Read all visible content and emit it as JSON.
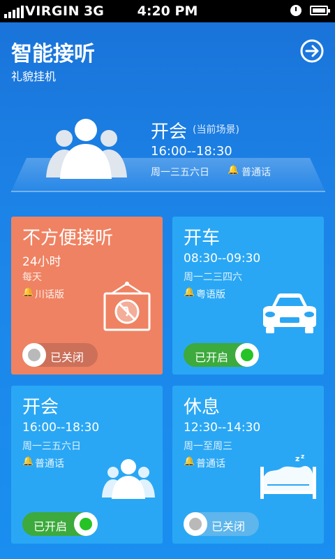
{
  "status_bar": {
    "carrier": "VIRGIN",
    "network": "3G",
    "time": "4:20 PM"
  },
  "header": {
    "title": "智能接听",
    "subtitle": "礼貌挂机"
  },
  "current": {
    "name": "开会",
    "tag": "(当前场景)",
    "time": "16:00--18:30",
    "days": "周一三五六日",
    "voice": "普通话"
  },
  "cards": [
    {
      "name": "不方便接听",
      "time": "24小时",
      "days": "每天",
      "voice": "川话版",
      "icon": "no-phone-sign-icon",
      "toggle_label": "已关闭",
      "on": false,
      "color": "#ef8262"
    },
    {
      "name": "开车",
      "time": "08:30--09:30",
      "days": "周一二三四六",
      "voice": "粤语版",
      "icon": "car-icon",
      "toggle_label": "已开启",
      "on": true,
      "color": "#2aa7f4"
    },
    {
      "name": "开会",
      "time": "16:00--18:30",
      "days": "周一三五六日",
      "voice": "普通话",
      "icon": "people-icon",
      "toggle_label": "已开启",
      "on": true,
      "color": "#2aa7f4"
    },
    {
      "name": "休息",
      "time": "12:30--14:30",
      "days": "周一至周三",
      "voice": "普通话",
      "icon": "bed-icon",
      "toggle_label": "已关闭",
      "on": false,
      "color": "#2aa7f4"
    }
  ]
}
